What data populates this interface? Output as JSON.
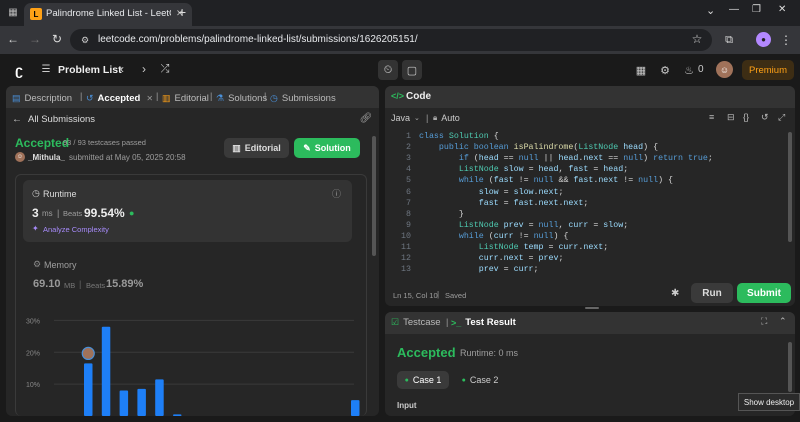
{
  "browser": {
    "tab_title": "Palindrome Linked List - LeetCo",
    "url": "leetcode.com/problems/palindrome-linked-list/submissions/1626205151/",
    "new_tab_symbol": "+",
    "window_controls": [
      "⌄",
      "—",
      "❐",
      "✕"
    ]
  },
  "header": {
    "problem_list_label": "Problem List",
    "streak_count": "0",
    "premium_label": "Premium"
  },
  "left_panel": {
    "tabs": [
      {
        "label": "Description",
        "icon": "description-icon"
      },
      {
        "label": "Accepted",
        "icon": "history-icon"
      },
      {
        "label": "Editorial",
        "icon": "book-icon"
      },
      {
        "label": "Solutions",
        "icon": "flask-icon"
      },
      {
        "label": "Submissions",
        "icon": "clock-icon"
      }
    ],
    "tab_close": "✕",
    "all_submissions_label": "All Submissions",
    "status": "Accepted",
    "testcases": "93 / 93 testcases passed",
    "username": "_Mithula_",
    "submitted_at": "submitted at May 05, 2025 20:58",
    "editorial_button": "Editorial",
    "solution_button": "Solution",
    "runtime": {
      "label": "Runtime",
      "value": "3",
      "unit": "ms",
      "beats_label": "Beats",
      "beats_value": "99.54%",
      "analyze_label": "Analyze Complexity"
    },
    "memory": {
      "label": "Memory",
      "value": "69.10",
      "unit": "MB",
      "beats_label": "Beats",
      "beats_value": "15.89%"
    },
    "chart_data": {
      "type": "bar",
      "ylabel": "",
      "ytick_labels": [
        "30%",
        "20%",
        "10%"
      ],
      "ylim": [
        0,
        32
      ],
      "values": [
        16.5,
        28,
        8,
        8.5,
        11.5,
        0.5,
        0,
        0,
        0,
        0,
        0,
        0,
        0,
        0,
        0,
        5
      ],
      "highlight_index": 0,
      "color": "#1e7ff7"
    }
  },
  "code_panel": {
    "title": "Code",
    "language": "Java",
    "auto_label": "Auto",
    "lines": [
      {
        "n": "1",
        "code": "class Solution {"
      },
      {
        "n": "2",
        "code": "    public boolean isPalindrome(ListNode head) {"
      },
      {
        "n": "3",
        "code": "        if (head == null || head.next == null) return true;"
      },
      {
        "n": "4",
        "code": "        ListNode slow = head, fast = head;"
      },
      {
        "n": "5",
        "code": "        while (fast != null && fast.next != null) {"
      },
      {
        "n": "6",
        "code": "            slow = slow.next;"
      },
      {
        "n": "7",
        "code": "            fast = fast.next.next;"
      },
      {
        "n": "8",
        "code": "        }"
      },
      {
        "n": "9",
        "code": "        ListNode prev = null, curr = slow;"
      },
      {
        "n": "10",
        "code": "        while (curr != null) {"
      },
      {
        "n": "11",
        "code": "            ListNode temp = curr.next;"
      },
      {
        "n": "12",
        "code": "            curr.next = prev;"
      },
      {
        "n": "13",
        "code": "            prev = curr;"
      }
    ],
    "status_position": "Ln 15, Col 10",
    "status_saved": "Saved",
    "run_label": "Run",
    "submit_label": "Submit"
  },
  "result_panel": {
    "tabs": [
      {
        "label": "Testcase"
      },
      {
        "label": "Test Result"
      }
    ],
    "status": "Accepted",
    "runtime": "Runtime: 0 ms",
    "cases": [
      {
        "label": "Case 1"
      },
      {
        "label": "Case 2"
      }
    ],
    "input_label": "Input"
  },
  "tooltip": "Show desktop",
  "colors": {
    "accent_green": "#2cbb5d",
    "bar_blue": "#1e7ff7",
    "premium_orange": "#ffa116"
  }
}
